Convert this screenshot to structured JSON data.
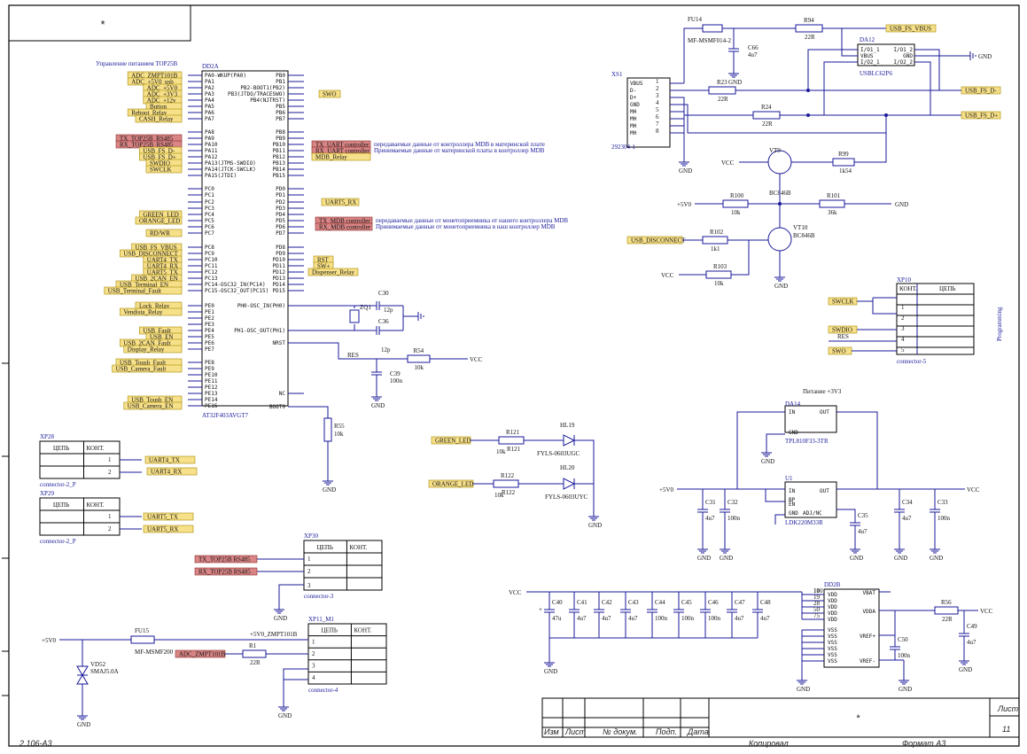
{
  "frame": {
    "star_top": "*",
    "star_bottom": "*",
    "sheet_label": "Лист",
    "sheet_no": "11",
    "left_code": "2.106-А3",
    "copied": "Копировал",
    "format": "Формат А3",
    "cols": [
      "Изм",
      "Лист",
      "№ докум.",
      "Подп.",
      "Дата"
    ]
  },
  "mcu": {
    "ref": "DD2A",
    "part": "AT32F403AVGT7",
    "title": "Управление питанием TOP25B",
    "left_pins": [
      "PA0-WKUP(PA0)",
      "PA1",
      "PA2",
      "PA3",
      "PA4",
      "PA5",
      "PA6",
      "PA7",
      "PA8",
      "PA9",
      "PA10",
      "PA11",
      "PA12",
      "PA13(JTMS-SWDIO)",
      "PA14(JTCK-SWCLK)",
      "PA15(JTDI)",
      "PC0",
      "PC1",
      "PC2",
      "PC3",
      "PC4",
      "PC5",
      "PC6",
      "PC7",
      "PC8",
      "PC9",
      "PC10",
      "PC11",
      "PC12",
      "PC13",
      "PC14-OSC32_IN(PC14)",
      "PC15-OSC32_OUT(PC15)",
      "PE0",
      "PE1",
      "PE2",
      "PE3",
      "PE4",
      "PE5",
      "PE6",
      "PE7",
      "PE8",
      "PE9",
      "PE10",
      "PE11",
      "PE12",
      "PE13",
      "PE14",
      "PE15"
    ],
    "right_pins": [
      "PB0",
      "PB1",
      "PB2-BOOT1(PB2)",
      "PB3(JTDO/TRACESWO)",
      "PB4(NJTRST)",
      "PB5",
      "PB6",
      "PB7",
      "PB8",
      "PB9",
      "PB10",
      "PB11",
      "PB12",
      "PB13",
      "PB14",
      "PB15",
      "PD0",
      "PD1",
      "PD2",
      "PD3",
      "PD4",
      "PD5",
      "PD6",
      "PD7",
      "PD8",
      "PD9",
      "PD10",
      "PD11",
      "PD12",
      "PD13",
      "PD14",
      "PD15",
      "PH0-OSC_IN(PH0)",
      "PH1-OSC_OUT(PH1)",
      "NRST",
      "NC",
      "BOOT0"
    ]
  },
  "nets_left": [
    "ADC_ZMPT101B",
    "ADC_+5V0_usb",
    "ADC_+5V0",
    "ADC_+3V3",
    "ADC_+12v",
    "Button",
    "Reboot_Relay",
    "CASH_Relay",
    "TX_TOP25B_RS485",
    "RX_TOP25B_RS485",
    "USB_FS_D-",
    "USB_FS_D+",
    "SWDIO",
    "SWCLK",
    "GREEN_LED",
    "ORANGE_LED",
    "RD/WR",
    "USB_FS_VBUS",
    "USB_DISCONNECT",
    "UART4_TX",
    "UART4_RX",
    "UART5_TX",
    "USB_2CAN_EN",
    "USB_Terminal_EN",
    "USB_Terminal_Fault",
    "Lock_Relay",
    "Vendista_Relay",
    "USB_Fault",
    "USB_EN",
    "USB_2CAN_Fault",
    "Display_Relay",
    "USB_Toush_Fault",
    "USB_Camera_Fault",
    "USB_Toush_EN",
    "USB_Camera_EN"
  ],
  "nets_right": [
    "SWO",
    "TX_UART controller",
    "RX_UART controller",
    "MDB_Relay",
    "UART5_RX",
    "TX_MDB controller",
    "RX_MDB controller",
    "RST",
    "SW+",
    "Dispenser_Relay",
    "RES"
  ],
  "comments": [
    "передаваемые данные от контроллера MDB в материнской плате",
    "Принимаемые данные от материнской платы в контроллер MDB",
    "передаваемые данные от монетоприемника от нашего контроллера MDB",
    "Принимаемые данные от монетоприемника в наш контроллер MDB"
  ],
  "usb": {
    "fuse": "FU14",
    "fuse_part": "MF-MSMF014-2",
    "r94": "R94",
    "r94v": "22R",
    "c66": "C66",
    "c66v": "4u7",
    "tvs": "DA12",
    "tvs_part": "USBLC62P6",
    "conn": "XS1",
    "conn_part": "292304-1",
    "conn_pins": [
      "VBUS",
      "D-",
      "D+",
      "GND",
      "MH",
      "MH",
      "MH",
      "MH"
    ],
    "r23": "R23",
    "r23v": "22R",
    "r24": "R24",
    "r24v": "22R",
    "vbus": "USB_FS_VBUS",
    "dm": "USB_FS_D-",
    "dp": "USB_FS_D+",
    "tvs_pins": [
      "I/O1_1",
      "VBUS",
      "I/O2_1",
      "I/O1_2",
      "GND",
      "I/O2_2"
    ]
  },
  "disc": {
    "vt9": "VT9",
    "vt9p": "BC846B",
    "r99": "R99",
    "r99v": "1k54",
    "r100": "R100",
    "r100v": "10k",
    "r101": "R101",
    "r101v": "36k",
    "vt10": "VT10",
    "vt10p": "BC846B",
    "r102": "R102",
    "r102v": "1k1",
    "r103": "R103",
    "r103v": "10k",
    "net": "USB_DISCONNECT"
  },
  "prog": {
    "ref": "XP10",
    "part": "connector-5",
    "h1": "КОНТ.",
    "h2": "ЦЕПЬ",
    "nets": [
      "SWCLK",
      "SWDIO",
      "RES",
      "SWO"
    ],
    "side": "Programming"
  },
  "osc": {
    "zq": "ZQ1",
    "c30": "C30",
    "c36": "C36",
    "cv": "12p",
    "r54": "R54",
    "r54v": "10k",
    "c39": "C39",
    "c39v": "100n",
    "r55": "R55",
    "r55v": "10k",
    "res": "RES"
  },
  "leds": {
    "r121": "R121",
    "r122": "R122",
    "rv": "10k",
    "hl19": "HL19",
    "hl19p": "FYLS-0603UGC",
    "hl20": "HL20",
    "hl20p": "FYLS-0603UYC",
    "g": "GREEN_LED",
    "o": "ORANGE_LED"
  },
  "power": {
    "title": "Питание +3V3",
    "da14": "DA14",
    "da14p": "TPL810F33-3TR",
    "u1": "U1",
    "u1p": "LDK220M33R",
    "caps": [
      [
        "C31",
        "4u7"
      ],
      [
        "C32",
        "100n"
      ],
      [
        "C35",
        "4u7"
      ],
      [
        "C34",
        "4u7"
      ],
      [
        "C33",
        "100n"
      ]
    ],
    "u_pins": [
      "IN",
      "BP",
      "EN",
      "GND",
      "ADJ/NC",
      "OUT"
    ]
  },
  "conns": [
    {
      "ref": "XP28",
      "part": "connector-2_P",
      "nets": [
        "UART4_TX",
        "UART4_RX"
      ]
    },
    {
      "ref": "XP29",
      "part": "connector-2_P",
      "nets": [
        "UART5_TX",
        "UART5_RX"
      ]
    },
    {
      "ref": "XP30",
      "part": "connector-3",
      "nets": [
        "TX_TOP25B RS485",
        "RX_TOP25B RS485"
      ]
    },
    {
      "ref": "XP11_M1",
      "part": "connector-4",
      "nets": [
        "+5V0_ZMPT101B",
        "ADC_ZMPT101B"
      ]
    }
  ],
  "zmpt": {
    "fu": "FU15",
    "fup": "MF-MSMF200",
    "r1": "R1",
    "r1v": "22R",
    "vd": "VD52",
    "vdp": "SMAJ5.0A"
  },
  "decoup": {
    "ref": "DD2B",
    "caps": [
      [
        "C40",
        "47u"
      ],
      [
        "C41",
        "4u7"
      ],
      [
        "C42",
        "4u7"
      ],
      [
        "C43",
        "4u7"
      ],
      [
        "C44",
        "100n"
      ],
      [
        "C45",
        "100n"
      ],
      [
        "C46",
        "100n"
      ],
      [
        "C47",
        "4u7"
      ],
      [
        "C48",
        "4u7"
      ]
    ],
    "r56": "R56",
    "r56v": "22R",
    "c49": "C49",
    "c49v": "4u7",
    "c50": "C50",
    "c50v": "100n",
    "pins_l": [
      "VDD",
      "VDD",
      "VDD",
      "VDD",
      "VDD",
      "VSS",
      "VSS",
      "VSS",
      "VSS",
      "VSS",
      "VSS"
    ],
    "pins_r": [
      "VBAT",
      "VDDA",
      "VREF+",
      "VREF-"
    ]
  },
  "rails": {
    "vcc": "VCC",
    "v5": "+5V0",
    "gnd": "GND"
  },
  "h1": "КОНТ.",
  "h2": "ЦЕПЬ"
}
